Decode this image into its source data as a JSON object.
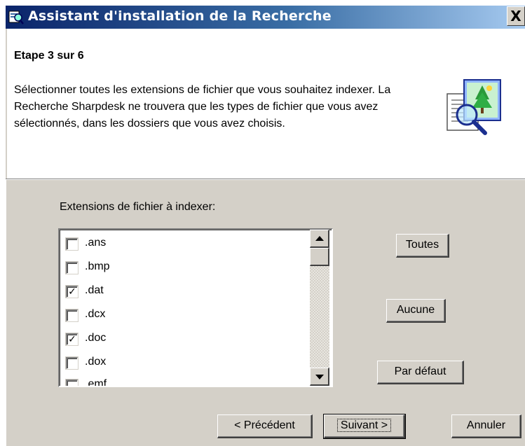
{
  "window": {
    "title": "Assistant d'installation de la Recherche",
    "close_label": "X"
  },
  "header": {
    "step": "Etape 3 sur 6",
    "description": "Sélectionner toutes les extensions de fichier que vous souhaitez indexer. La Recherche Sharpdesk ne trouvera que les types de fichier que vous avez sélectionnés, dans les dossiers que vous avez choisis."
  },
  "extensions": {
    "label": "Extensions de fichier à indexer:",
    "items": [
      {
        "label": ".ans",
        "checked": false
      },
      {
        "label": ".bmp",
        "checked": false
      },
      {
        "label": ".dat",
        "checked": true
      },
      {
        "label": ".dcx",
        "checked": false
      },
      {
        "label": ".doc",
        "checked": true
      },
      {
        "label": ".dox",
        "checked": false
      },
      {
        "label": ".emf",
        "checked": false
      }
    ],
    "check_mark": "✓"
  },
  "side_buttons": {
    "all": "Toutes",
    "none": "Aucune",
    "default": "Par défaut"
  },
  "nav_buttons": {
    "back": "< Précédent",
    "next": "Suivant >",
    "cancel": "Annuler"
  }
}
